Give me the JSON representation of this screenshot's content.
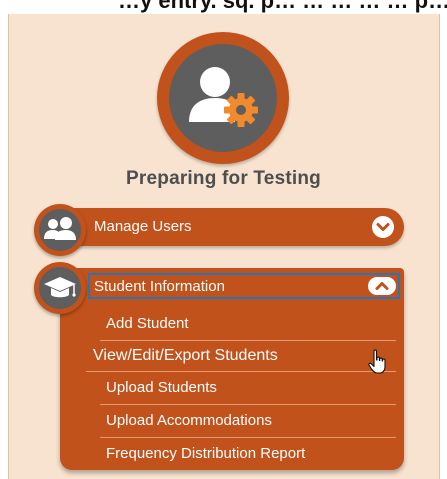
{
  "top_strip_text": "…y entry. sq. p… … … … … p…",
  "section": {
    "title": "Preparing for Testing"
  },
  "menu": {
    "manage_users": {
      "label": "Manage Users",
      "expanded": false
    },
    "student_information": {
      "label": "Student Information",
      "expanded": true,
      "items": [
        "Add Student",
        "View/Edit/Export Students",
        "Upload Students",
        "Upload Accommodations",
        "Frequency Distribution Report"
      ]
    }
  },
  "icons": {
    "hero": "user-gear-icon",
    "manage_users": "users-group-icon",
    "student_information": "graduation-cap-icon",
    "collapsed_toggle": "chevron-down-icon",
    "expanded_toggle": "chevron-up-icon",
    "cursor": "hand-pointer-cursor-icon"
  },
  "colors": {
    "panel_background": "#f7e3cf",
    "accent_orange": "#c1521b",
    "icon_gray": "#5e5e5e",
    "focus_outline": "#2a74b8"
  }
}
